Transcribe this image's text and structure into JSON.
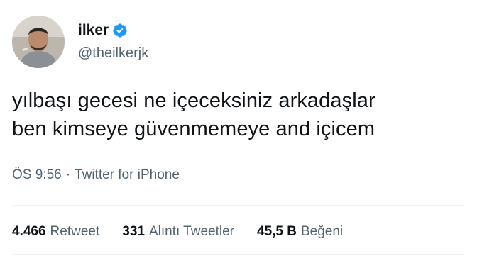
{
  "author": {
    "display_name": "ilker",
    "handle": "@theilkerjk",
    "verified_icon": "verified-badge-icon",
    "badge_color": "#1d9bf0"
  },
  "tweet": {
    "lines": [
      "yılbaşı gecesi ne içeceksiniz arkadaşlar",
      "ben kimseye güvenmemeye and içicem"
    ]
  },
  "meta": {
    "time": "ÖS 9:56",
    "separator": "·",
    "source": "Twitter for iPhone"
  },
  "stats": [
    {
      "value": "4.466",
      "label": "Retweet"
    },
    {
      "value": "331",
      "label": "Alıntı Tweetler"
    },
    {
      "value": "45,5 B",
      "label": "Beğeni"
    }
  ]
}
